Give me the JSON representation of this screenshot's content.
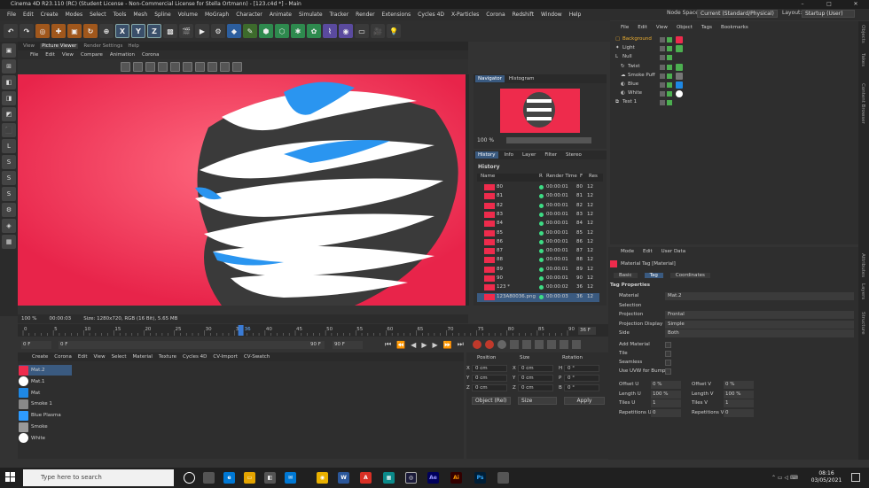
{
  "window": {
    "title": "Cinema 4D R23.110 (RC) (Student License - Non-Commercial License for Stella Ortmann) - [123.c4d *] - Main",
    "controls": [
      "–",
      "□",
      "✕"
    ]
  },
  "menubar": {
    "items": [
      "File",
      "Edit",
      "Create",
      "Modes",
      "Select",
      "Tools",
      "Mesh",
      "Spline",
      "Volume",
      "MoGraph",
      "Character",
      "Animate",
      "Simulate",
      "Tracker",
      "Render",
      "Extensions",
      "Cycles 4D",
      "X-Particles",
      "Corona",
      "Redshift",
      "Window",
      "Help"
    ],
    "node_space_label": "Node Space:",
    "node_space_value": "Current (Standard/Physical)",
    "layout_label": "Layout:",
    "layout_value": "Startup (User)"
  },
  "toolbar": {
    "axis_buttons": [
      "X",
      "Y",
      "Z"
    ]
  },
  "left_tools": [
    "▣",
    "⊞",
    "◧",
    "◨",
    "◩",
    "⬛",
    "L",
    "S",
    "S",
    "S",
    "⚙",
    "◈",
    "▦"
  ],
  "viewport": {
    "tabs": [
      "View",
      "Picture Viewer",
      "Render Settings",
      "Help"
    ],
    "menu": [
      "File",
      "Edit",
      "View",
      "Compare",
      "Animation",
      "Corona"
    ],
    "status_zoom": "100 %",
    "status_time": "00:00:03",
    "status_info": "Size: 1280x720, RGB (16 Bit), 5.65 MB"
  },
  "navigator": {
    "tabs": [
      "Navigator",
      "Histogram"
    ],
    "zoom": "100 %"
  },
  "history": {
    "tabs": [
      "History",
      "Info",
      "Layer",
      "Filter",
      "Stereo"
    ],
    "title": "History",
    "columns": [
      "Name",
      "R",
      "Render Time",
      "F",
      "Res"
    ],
    "rows": [
      {
        "name": "80",
        "time": "00:00:01",
        "f": "80",
        "res": "12"
      },
      {
        "name": "81",
        "time": "00:00:01",
        "f": "81",
        "res": "12"
      },
      {
        "name": "82",
        "time": "00:00:01",
        "f": "82",
        "res": "12"
      },
      {
        "name": "83",
        "time": "00:00:01",
        "f": "83",
        "res": "12"
      },
      {
        "name": "84",
        "time": "00:00:01",
        "f": "84",
        "res": "12"
      },
      {
        "name": "85",
        "time": "00:00:01",
        "f": "85",
        "res": "12"
      },
      {
        "name": "86",
        "time": "00:00:01",
        "f": "86",
        "res": "12"
      },
      {
        "name": "87",
        "time": "00:00:01",
        "f": "87",
        "res": "12"
      },
      {
        "name": "88",
        "time": "00:00:01",
        "f": "88",
        "res": "12"
      },
      {
        "name": "89",
        "time": "00:00:01",
        "f": "89",
        "res": "12"
      },
      {
        "name": "90",
        "time": "00:00:01",
        "f": "90",
        "res": "12"
      },
      {
        "name": "123 *",
        "time": "00:00:02",
        "f": "36",
        "res": "12"
      },
      {
        "name": "123A80036.png",
        "time": "00:00:03",
        "f": "36",
        "res": "12"
      }
    ]
  },
  "timeline": {
    "ticks": [
      "0",
      "5",
      "10",
      "15",
      "20",
      "25",
      "30",
      "35",
      "40",
      "45",
      "50",
      "55",
      "60",
      "65",
      "70",
      "75",
      "80",
      "85",
      "90"
    ],
    "current": "36",
    "end_frame": "36 F"
  },
  "playbar": {
    "start": "0 F",
    "start2": "0 F",
    "end": "90 F",
    "end2": "90 F"
  },
  "material_manager": {
    "menu": [
      "Create",
      "Corona",
      "Edit",
      "View",
      "Select",
      "Material",
      "Texture",
      "Cycles 4D",
      "CV-Import",
      "CV-Swatch"
    ],
    "materials": [
      {
        "name": "Mat.2",
        "color": "#ee2b4c"
      },
      {
        "name": "Mat.1",
        "color": "#ffffff"
      },
      {
        "name": "Mat",
        "color": "#1e88e5"
      },
      {
        "name": "Smoke 1",
        "color": "#888888"
      },
      {
        "name": "Blue Plasma",
        "color": "#2e9bff"
      },
      {
        "name": "Smoke",
        "color": "#999999"
      },
      {
        "name": "White",
        "color": "#ffffff"
      }
    ]
  },
  "coordinates": {
    "headers": [
      "Position",
      "Size",
      "Rotation"
    ],
    "rows": [
      {
        "axis": "X",
        "pos": "0 cm",
        "size": "0 cm",
        "rot_axis": "H",
        "rot": "0 °"
      },
      {
        "axis": "Y",
        "pos": "0 cm",
        "size": "0 cm",
        "rot_axis": "P",
        "rot": "0 °"
      },
      {
        "axis": "Z",
        "pos": "0 cm",
        "size": "0 cm",
        "rot_axis": "B",
        "rot": "0 °"
      }
    ],
    "mode": "Object (Rel)",
    "size_mode": "Size",
    "apply": "Apply"
  },
  "object_manager": {
    "menu": [
      "File",
      "Edit",
      "View",
      "Object",
      "Tags",
      "Bookmarks"
    ],
    "objects": [
      {
        "name": "Background",
        "icon": "▢"
      },
      {
        "name": "Light",
        "icon": "✦"
      },
      {
        "name": "Null",
        "icon": "L"
      },
      {
        "name": "Twist",
        "icon": "↻"
      },
      {
        "name": "Smoke Puff",
        "icon": "☁"
      },
      {
        "name": "Blue",
        "icon": "◐"
      },
      {
        "name": "White",
        "icon": "◐"
      },
      {
        "name": "Test 1",
        "icon": "⧉"
      }
    ]
  },
  "attributes": {
    "menu": [
      "Mode",
      "Edit",
      "User Data"
    ],
    "title": "Material Tag [Material]",
    "tabs": [
      "Basic",
      "Tag",
      "Coordinates"
    ],
    "section": "Tag Properties",
    "props": [
      {
        "label": "Material",
        "value": "Mat.2"
      },
      {
        "label": "Selection",
        "value": ""
      },
      {
        "label": "Projection",
        "value": "Frontal"
      },
      {
        "label": "Projection Display",
        "value": "Simple"
      },
      {
        "label": "Side",
        "value": "Both"
      }
    ],
    "checks": [
      "Add Material",
      "Tile",
      "Seamless",
      "Use UVW for Bump"
    ],
    "offset_u_label": "Offset U",
    "offset_u": "0 %",
    "offset_v_label": "Offset V",
    "offset_v": "0 %",
    "length_u_label": "Length U",
    "length_u": "100 %",
    "length_v_label": "Length V",
    "length_v": "100 %",
    "tiles_u_label": "Tiles U",
    "tiles_u": "1",
    "tiles_v_label": "Tiles V",
    "tiles_v": "1",
    "rep_u_label": "Repetitions U",
    "rep_u": "0",
    "rep_v_label": "Repetitions V",
    "rep_v": "0"
  },
  "right_strip": [
    "Objects",
    "Takes",
    "Content Browser",
    "Attributes",
    "Layers",
    "Structure"
  ],
  "taskbar": {
    "search_placeholder": "Type here to search",
    "time": "08:16",
    "date": "03/05/2021"
  }
}
